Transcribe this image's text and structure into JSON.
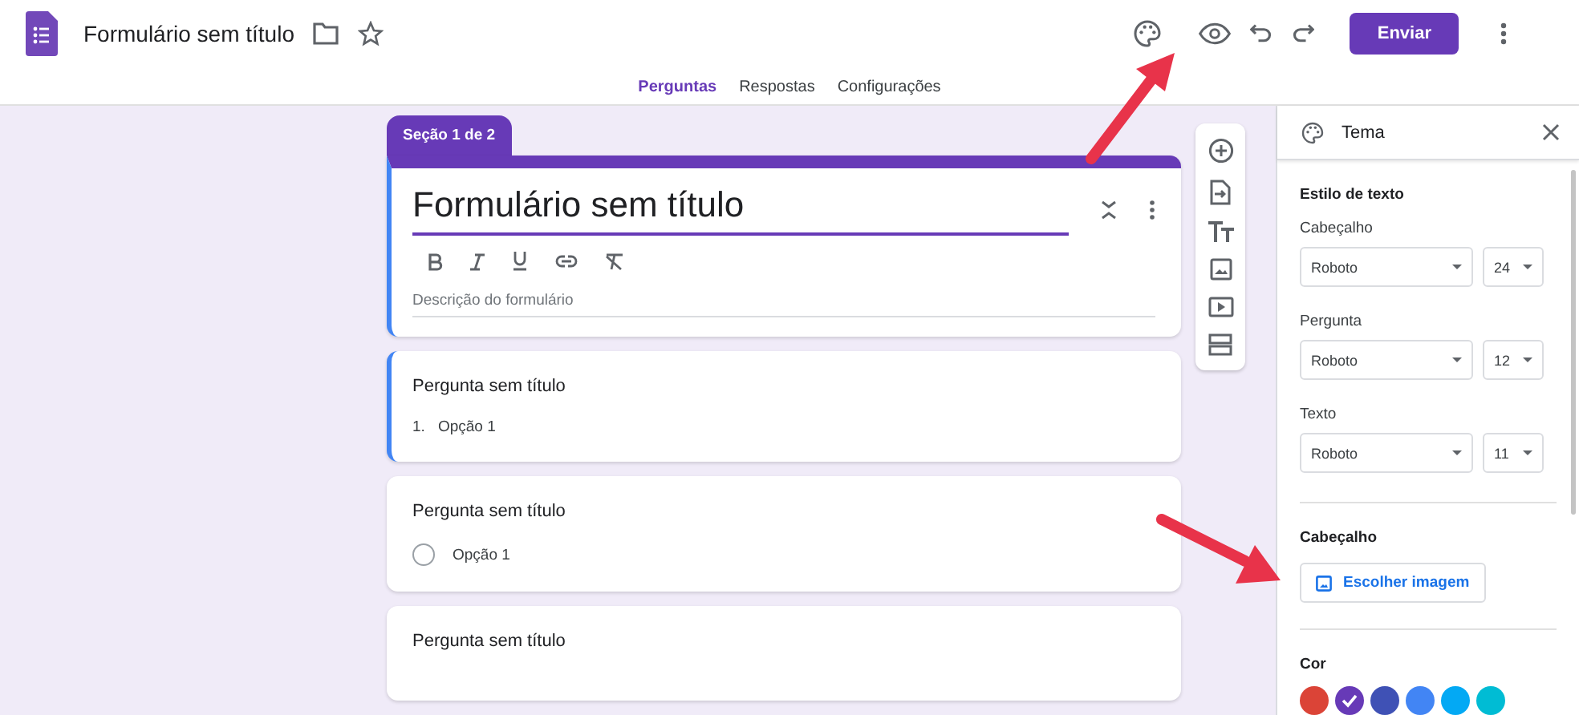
{
  "header": {
    "title": "Formulário sem título",
    "send_button": "Enviar"
  },
  "tabs": [
    {
      "label": "Perguntas",
      "selected": true
    },
    {
      "label": "Respostas",
      "selected": false
    },
    {
      "label": "Configurações",
      "selected": false
    }
  ],
  "form": {
    "section_badge": "Seção 1 de 2",
    "title": "Formulário sem título",
    "description_placeholder": "Descrição do formulário",
    "questions": [
      {
        "title": "Pergunta sem título",
        "kind": "numbered",
        "option_number": "1.",
        "option": "Opção 1"
      },
      {
        "title": "Pergunta sem título",
        "kind": "radio",
        "option": "Opção 1",
        "selected": false
      },
      {
        "title": "Pergunta sem título",
        "kind": "none"
      }
    ]
  },
  "theme_panel": {
    "title": "Tema",
    "text_style_heading": "Estilo de texto",
    "fonts": [
      {
        "label": "Cabeçalho",
        "font": "Roboto",
        "size": "24"
      },
      {
        "label": "Pergunta",
        "font": "Roboto",
        "size": "12"
      },
      {
        "label": "Texto",
        "font": "Roboto",
        "size": "11"
      }
    ],
    "header_heading": "Cabeçalho",
    "choose_image_button": "Escolher imagem",
    "color_heading": "Cor",
    "colors": [
      {
        "color": "#db4437",
        "selected": false
      },
      {
        "color": "#673ab7",
        "selected": true
      },
      {
        "color": "#3f51b5",
        "selected": false
      },
      {
        "color": "#4285f4",
        "selected": false
      },
      {
        "color": "#03a9f4",
        "selected": false
      },
      {
        "color": "#00bcd4",
        "selected": false
      }
    ]
  }
}
